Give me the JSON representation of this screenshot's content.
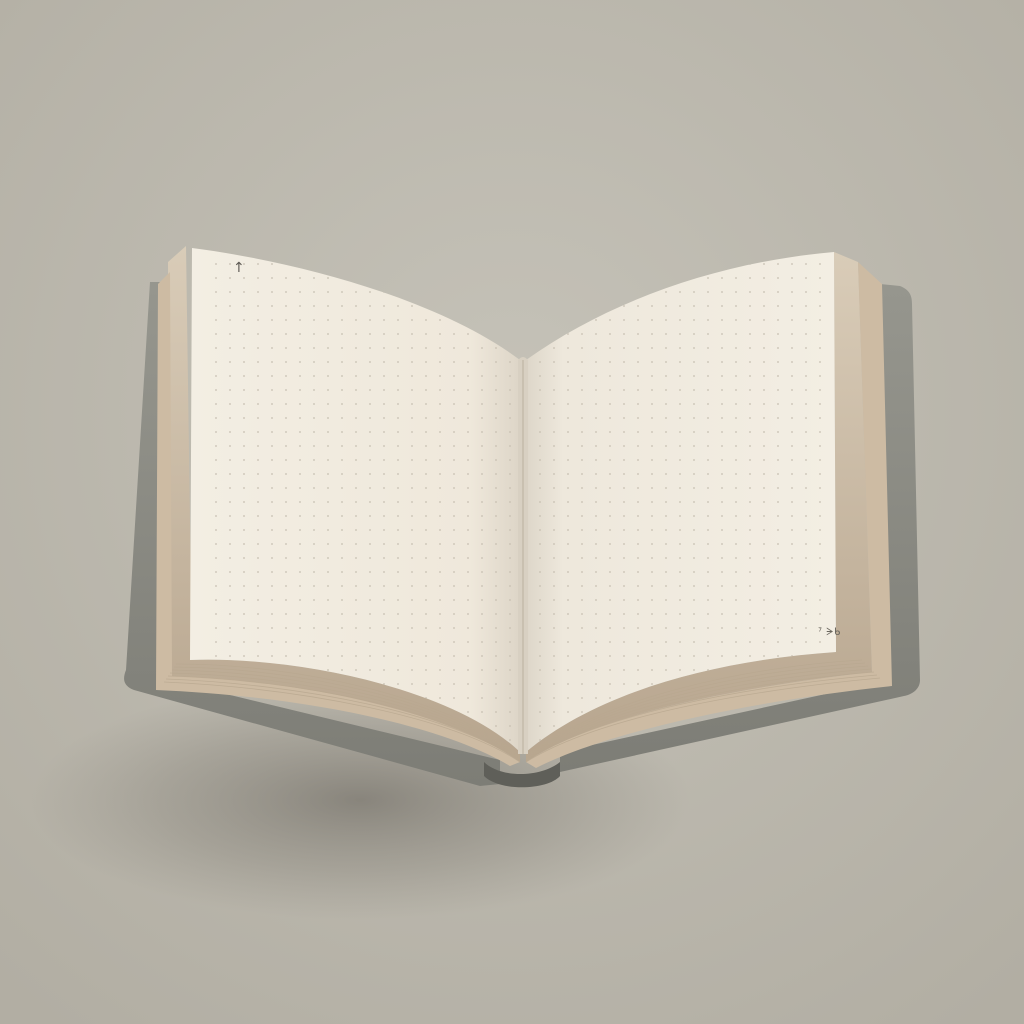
{
  "scene": {
    "subject": "open-dot-grid-notebook",
    "background_color": "#bcb8ad",
    "cover_color": "#8a8a82",
    "page_color": "#f2ece0",
    "page_edge_color": "#c9b9a3",
    "dot_color": "#c7c0b2",
    "shadow_color": "#6f6b63"
  },
  "pages": {
    "left": {
      "corner_mark": "↑",
      "icon": "arrow-up-icon"
    },
    "right": {
      "corner_mark": "⁷ ᗒᑲ"
    }
  }
}
